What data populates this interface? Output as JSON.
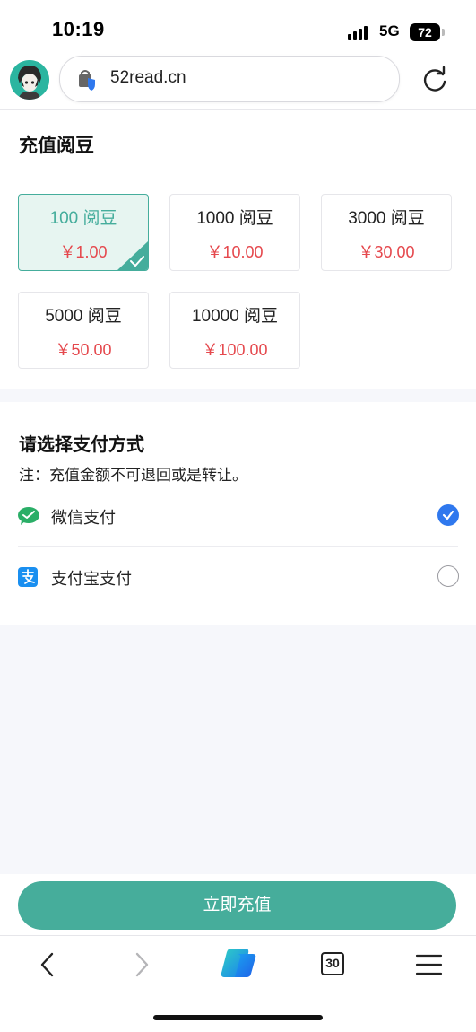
{
  "status_bar": {
    "time": "10:19",
    "network": "5G",
    "battery": "72"
  },
  "browser": {
    "url": "52read.cn",
    "tab_count": "30"
  },
  "recharge": {
    "title": "充值阅豆",
    "options": [
      {
        "beans": "100 阅豆",
        "price": "￥1.00",
        "selected": true
      },
      {
        "beans": "1000 阅豆",
        "price": "￥10.00"
      },
      {
        "beans": "3000 阅豆",
        "price": "￥30.00"
      },
      {
        "beans": "5000 阅豆",
        "price": "￥50.00"
      },
      {
        "beans": "10000 阅豆",
        "price": "￥100.00"
      }
    ]
  },
  "payment": {
    "title": "请选择支付方式",
    "note": "注：充值金额不可退回或是转让。",
    "methods": [
      {
        "label": "微信支付",
        "icon": "wechat-pay-icon",
        "selected": true
      },
      {
        "label": "支付宝支付",
        "icon": "alipay-icon",
        "selected": false
      }
    ]
  },
  "submit_label": "立即充值",
  "colors": {
    "accent": "#46ad9b",
    "price": "#e5484d",
    "radio": "#2f78ee"
  }
}
